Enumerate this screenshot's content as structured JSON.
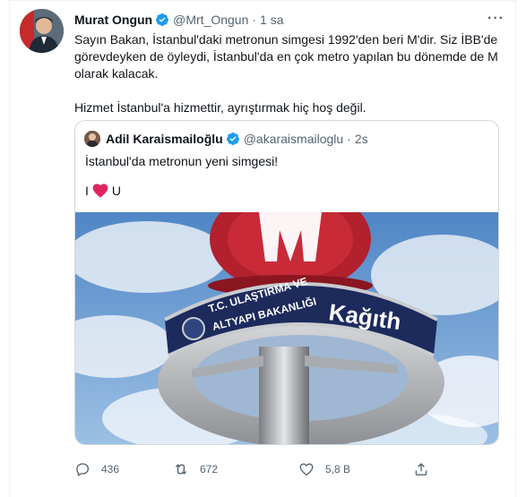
{
  "tweet": {
    "author_name": "Murat Ongun",
    "handle": "@Mrt_Ongun",
    "separator": "·",
    "time": "1 sa",
    "more_label": "···",
    "paragraphs": [
      "Sayın Bakan, İstanbul'daki metronun simgesi 1992'den beri M'dir. Siz İBB'de görevdeyken de öyleydi, İstanbul'da en çok metro yapılan bu dönemde de M olarak kalacak.",
      "Hizmet İstanbul'a hizmettir, ayrıştırmak hiç hoş değil."
    ]
  },
  "quoted": {
    "author_name": "Adil Karaismailoğlu",
    "handle": "@akaraismailoglu",
    "separator": "·",
    "time": "2s",
    "text": "İstanbul'da metronun yeni simgesi!",
    "heart_line_left": "I",
    "heart_line_right": "U",
    "sign_text_line1": "T.C. ULAŞTIRMA VE",
    "sign_text_line2": "ALTYAPI BAKANLIĞI",
    "sign_station": "Kağıth"
  },
  "actions": {
    "reply_count": "436",
    "retweet_count": "672",
    "like_count": "5,8 B"
  },
  "colors": {
    "verified": "#1d9bf0",
    "muted": "#536471",
    "heart": "#e0245e",
    "sign_red": "#b3202e",
    "sign_navy": "#1c2a5c"
  }
}
